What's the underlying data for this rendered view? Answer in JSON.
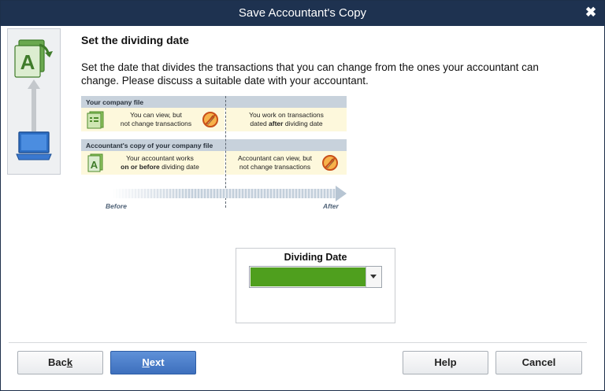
{
  "window": {
    "title": "Save Accountant's Copy",
    "close_glyph": "✖"
  },
  "step": {
    "heading": "Set the dividing date",
    "description": "Set the date that divides the transactions that you can change from the ones your accountant can change. Please discuss a suitable date with your accountant."
  },
  "diagram": {
    "company_file_label": "Your company file",
    "company_before_line1": "You can view, but",
    "company_before_line2": "not change transactions",
    "company_after_line1": "You work on transactions",
    "company_after_line2_pre": "dated ",
    "company_after_line2_bold": "after",
    "company_after_line2_post": " dividing date",
    "accountant_copy_label": "Accountant's copy of your company file",
    "accountant_before_line1": "Your accountant works",
    "accountant_before_line2_bold": "on or before",
    "accountant_before_line2_post": " dividing date",
    "accountant_after_line1": "Accountant can view, but",
    "accountant_after_line2": "not change transactions",
    "before_label": "Before",
    "after_label": "After"
  },
  "dividing_date": {
    "label": "Dividing Date",
    "value": "",
    "field_color": "#4f9f1e"
  },
  "buttons": {
    "back_pre": "Bac",
    "back_underline": "k",
    "next_underline": "N",
    "next_post": "ext",
    "help": "Help",
    "cancel": "Cancel"
  },
  "icons": {
    "window_icon": "accountant-copy-icon",
    "up_arrow": "arrow-up-icon",
    "laptop": "laptop-icon",
    "company_file": "company-file-icon",
    "no_edit": "no-edit-icon",
    "accountant_file": "accountant-file-icon",
    "dropdown": "chevron-down-icon"
  },
  "colors": {
    "titlebar": "#1e3250",
    "primary_button": "#3d6fbd",
    "band": "#c8d2dc",
    "cell": "#fdf8dc"
  }
}
